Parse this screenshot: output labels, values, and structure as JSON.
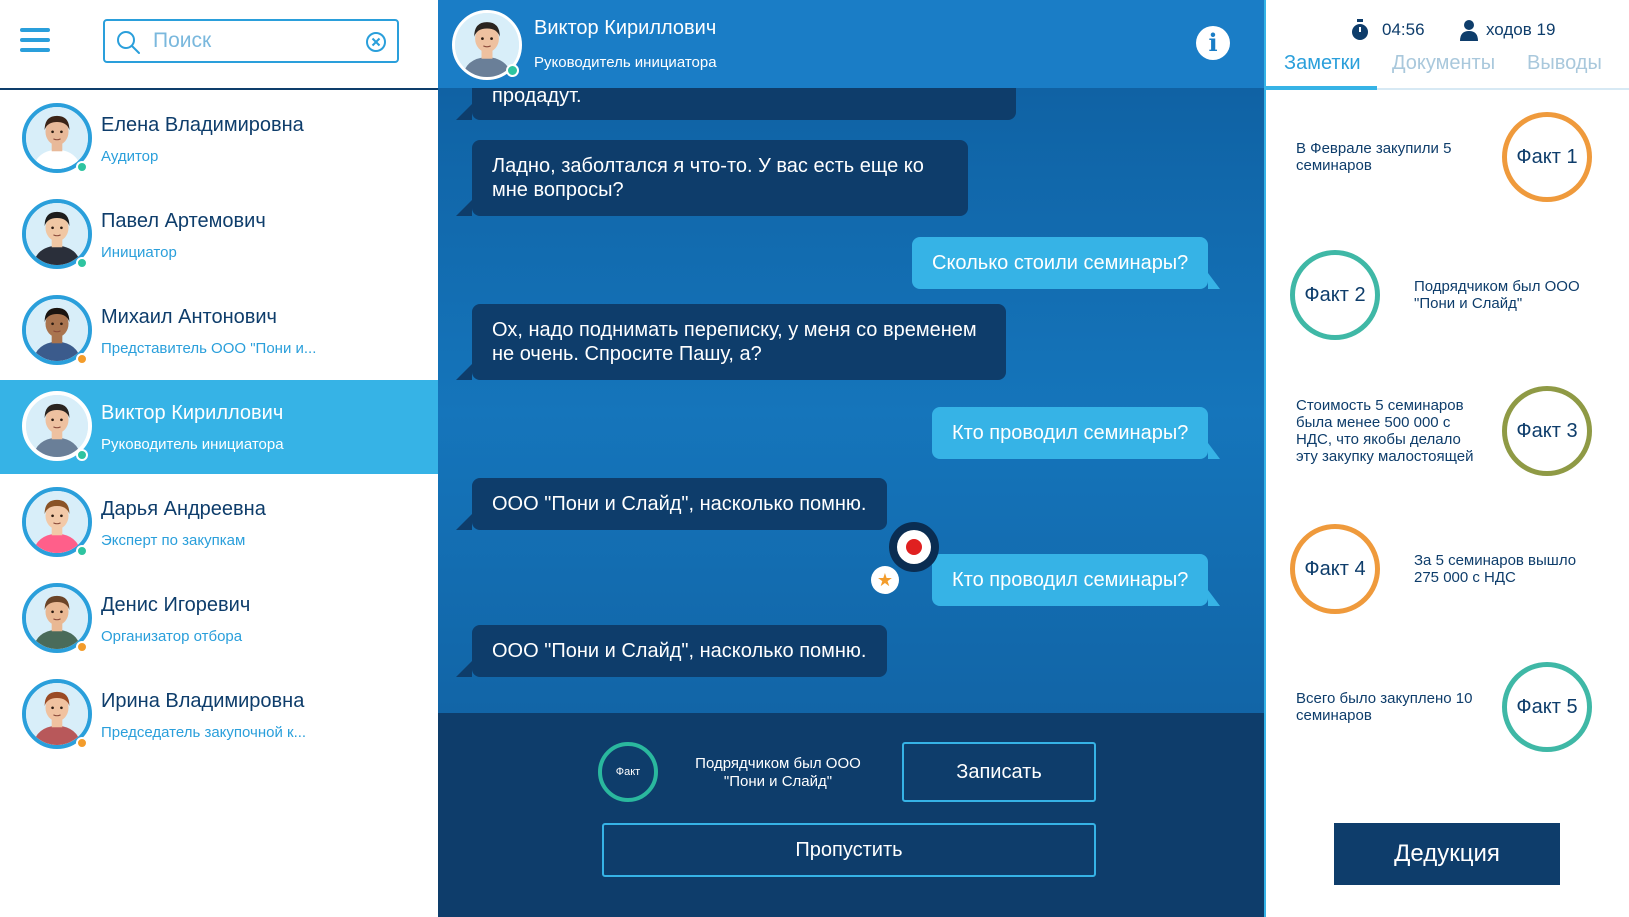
{
  "search": {
    "placeholder": "Поиск",
    "value": ""
  },
  "contacts": [
    {
      "name": "Елена Владимировна",
      "role": "Аудитор",
      "status": "green",
      "active": false,
      "skin": "#e8b999",
      "hair": "#3b2418",
      "shirt": "#ffffff"
    },
    {
      "name": "Павел Артемович",
      "role": "Инициатор",
      "status": "green",
      "active": false,
      "skin": "#f0c7a4",
      "hair": "#1d1d1d",
      "shirt": "#2a2f3a"
    },
    {
      "name": "Михаил Антонович",
      "role": "Представитель ООО \"Пони и...",
      "status": "orange",
      "active": false,
      "skin": "#a9744f",
      "hair": "#1a1410",
      "shirt": "#3b5b8c"
    },
    {
      "name": "Виктор Кириллович",
      "role": "Руководитель инициатора",
      "status": "green",
      "active": true,
      "skin": "#eec1a0",
      "hair": "#2a2420",
      "shirt": "#6a7f98"
    },
    {
      "name": "Дарья Андреевна",
      "role": "Эксперт по закупкам",
      "status": "green",
      "active": false,
      "skin": "#f2c9a8",
      "hair": "#8a5326",
      "shirt": "#ff5f8a"
    },
    {
      "name": "Денис Игоревич",
      "role": "Организатор отбора",
      "status": "orange",
      "active": false,
      "skin": "#e9b893",
      "hair": "#6b4428",
      "shirt": "#4a6b5a"
    },
    {
      "name": "Ирина Владимировна",
      "role": "Председатель закупочной к...",
      "status": "orange",
      "active": false,
      "skin": "#f0c2a0",
      "hair": "#9a4a24",
      "shirt": "#b8585a"
    }
  ],
  "chat_header": {
    "name": "Виктор Кириллович",
    "role": "Руководитель инициатора",
    "info_icon": "info-icon",
    "info_glyph": "i"
  },
  "messages": [
    {
      "from": "in",
      "text": "продадут."
    },
    {
      "from": "in",
      "text": "Ладно, заболтался я что-то. У вас есть еще ко мне вопросы?"
    },
    {
      "from": "out",
      "text": "Сколько стоили семинары?"
    },
    {
      "from": "in",
      "text": "Ох, надо поднимать переписку, у меня со временем не очень. Спросите Пашу, а?"
    },
    {
      "from": "out",
      "text": "Кто проводил семинары?"
    },
    {
      "from": "in",
      "text": "ООО \"Пони и Слайд\", насколько помню."
    },
    {
      "from": "out",
      "text": "Кто проводил семинары?"
    },
    {
      "from": "in",
      "text": "ООО \"Пони и Слайд\", насколько помню."
    }
  ],
  "star_glyph": "★",
  "pending_fact": {
    "ring_label": "Факт",
    "text": "Подрядчиком был ООО \"Пони и Слайд\""
  },
  "buttons": {
    "record": "Записать",
    "skip": "Пропустить",
    "deduction": "Дедукция"
  },
  "stats": {
    "timer": "04:56",
    "moves": "ходов 19"
  },
  "right_tabs": [
    "Заметки",
    "Документы",
    "Выводы"
  ],
  "facts": [
    {
      "label": "Факт 1",
      "text": "В Феврале закупили 5 семинаров",
      "color": "#ef9a3c"
    },
    {
      "label": "Факт 2",
      "text": "Подрядчиком был ООО \"Пони и Слайд\"",
      "color": "#3fb8a6"
    },
    {
      "label": "Факт 3",
      "text": "Стоимость 5 семинаров была менее 500 000 с НДС, что якобы делало эту закупку малостоящей",
      "color": "#8f9a45"
    },
    {
      "label": "Факт 4",
      "text": "За 5 семинаров вышло 275 000 с НДС",
      "color": "#ef9a3c"
    },
    {
      "label": "Факт 5",
      "text": "Всего было закуплено 10 семинаров",
      "color": "#3fb8a6"
    }
  ],
  "colors": {
    "brand_dark": "#0e3d6b",
    "brand_light": "#36b3e6",
    "accent": "#2a9fdb",
    "record_red": "#e02020"
  }
}
